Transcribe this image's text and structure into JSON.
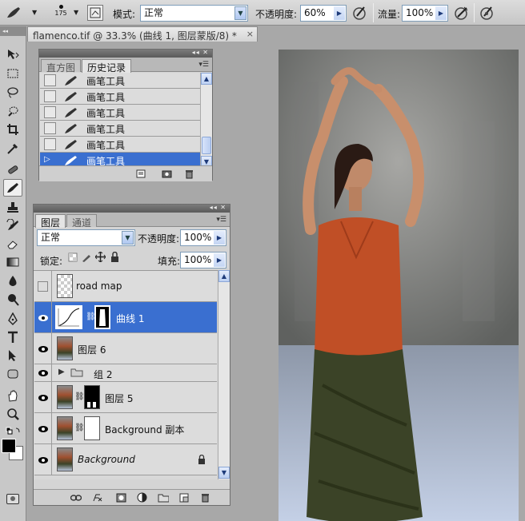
{
  "options_bar": {
    "brush_size": "175",
    "mode_label": "模式:",
    "mode_value": "正常",
    "opacity_label": "不透明度:",
    "opacity_value": "60%",
    "flow_label": "流量:",
    "flow_value": "100%"
  },
  "document": {
    "tab_title": "flamenco.tif @ 33.3% (曲线 1, 图层蒙版/8) *",
    "close_glyph": "×"
  },
  "history_panel": {
    "tabs": [
      "直方图",
      "历史记录"
    ],
    "active_tab": 1,
    "items": [
      {
        "label": "画笔工具"
      },
      {
        "label": "画笔工具"
      },
      {
        "label": "画笔工具"
      },
      {
        "label": "画笔工具"
      },
      {
        "label": "画笔工具"
      },
      {
        "label": "画笔工具"
      }
    ],
    "selected_index": 5
  },
  "layers_panel": {
    "tabs": [
      "图层",
      "通道"
    ],
    "active_tab": 0,
    "blend_mode": "正常",
    "opacity_label": "不透明度:",
    "opacity_value": "100%",
    "lock_label": "锁定:",
    "fill_label": "填充:",
    "fill_value": "100%",
    "layers": [
      {
        "name": "road map",
        "visible": false
      },
      {
        "name": "曲线 1",
        "visible": true,
        "selected": true
      },
      {
        "name": "图层 6",
        "visible": true
      },
      {
        "name": "组 2",
        "visible": true,
        "group": true
      },
      {
        "name": "图层 5",
        "visible": true
      },
      {
        "name": "Background 副本",
        "visible": true
      },
      {
        "name": "Background",
        "visible": true,
        "locked": true
      }
    ]
  },
  "colors": {
    "selection": "#3a6fd0",
    "foreground": "#000000",
    "background": "#ffffff"
  }
}
